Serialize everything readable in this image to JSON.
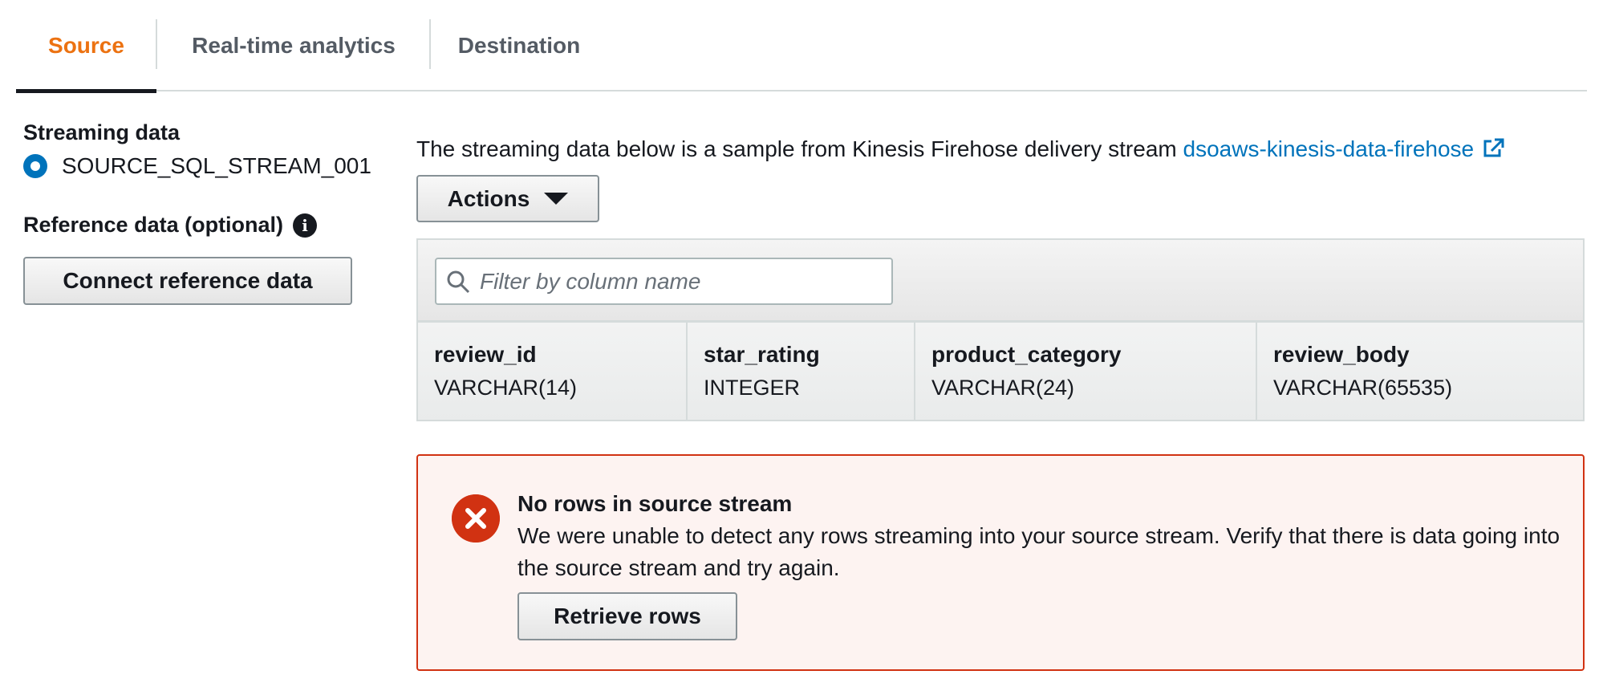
{
  "tabs": [
    {
      "label": "Source",
      "active": true
    },
    {
      "label": "Real-time analytics",
      "active": false
    },
    {
      "label": "Destination",
      "active": false
    }
  ],
  "left": {
    "streaming_title": "Streaming data",
    "stream_option": "SOURCE_SQL_STREAM_001",
    "reference_title": "Reference data (optional)",
    "connect_button": "Connect reference data"
  },
  "main": {
    "intro_text": "The streaming data below is a sample from Kinesis Firehose delivery stream ",
    "stream_link": "dsoaws-kinesis-data-firehose",
    "actions_button": "Actions",
    "filter_placeholder": "Filter by column name",
    "columns": [
      {
        "name": "review_id",
        "type": "VARCHAR(14)"
      },
      {
        "name": "star_rating",
        "type": "INTEGER"
      },
      {
        "name": "product_category",
        "type": "VARCHAR(24)"
      },
      {
        "name": "review_body",
        "type": "VARCHAR(65535)"
      }
    ]
  },
  "alert": {
    "title": "No rows in source stream",
    "message": "We were unable to detect any rows streaming into your source stream. Verify that there is data going into the source stream and try again.",
    "retrieve_button": "Retrieve rows"
  },
  "colors": {
    "active_tab": "#ec7211",
    "link": "#0073bb",
    "error": "#d13212",
    "radio": "#0073bb"
  }
}
